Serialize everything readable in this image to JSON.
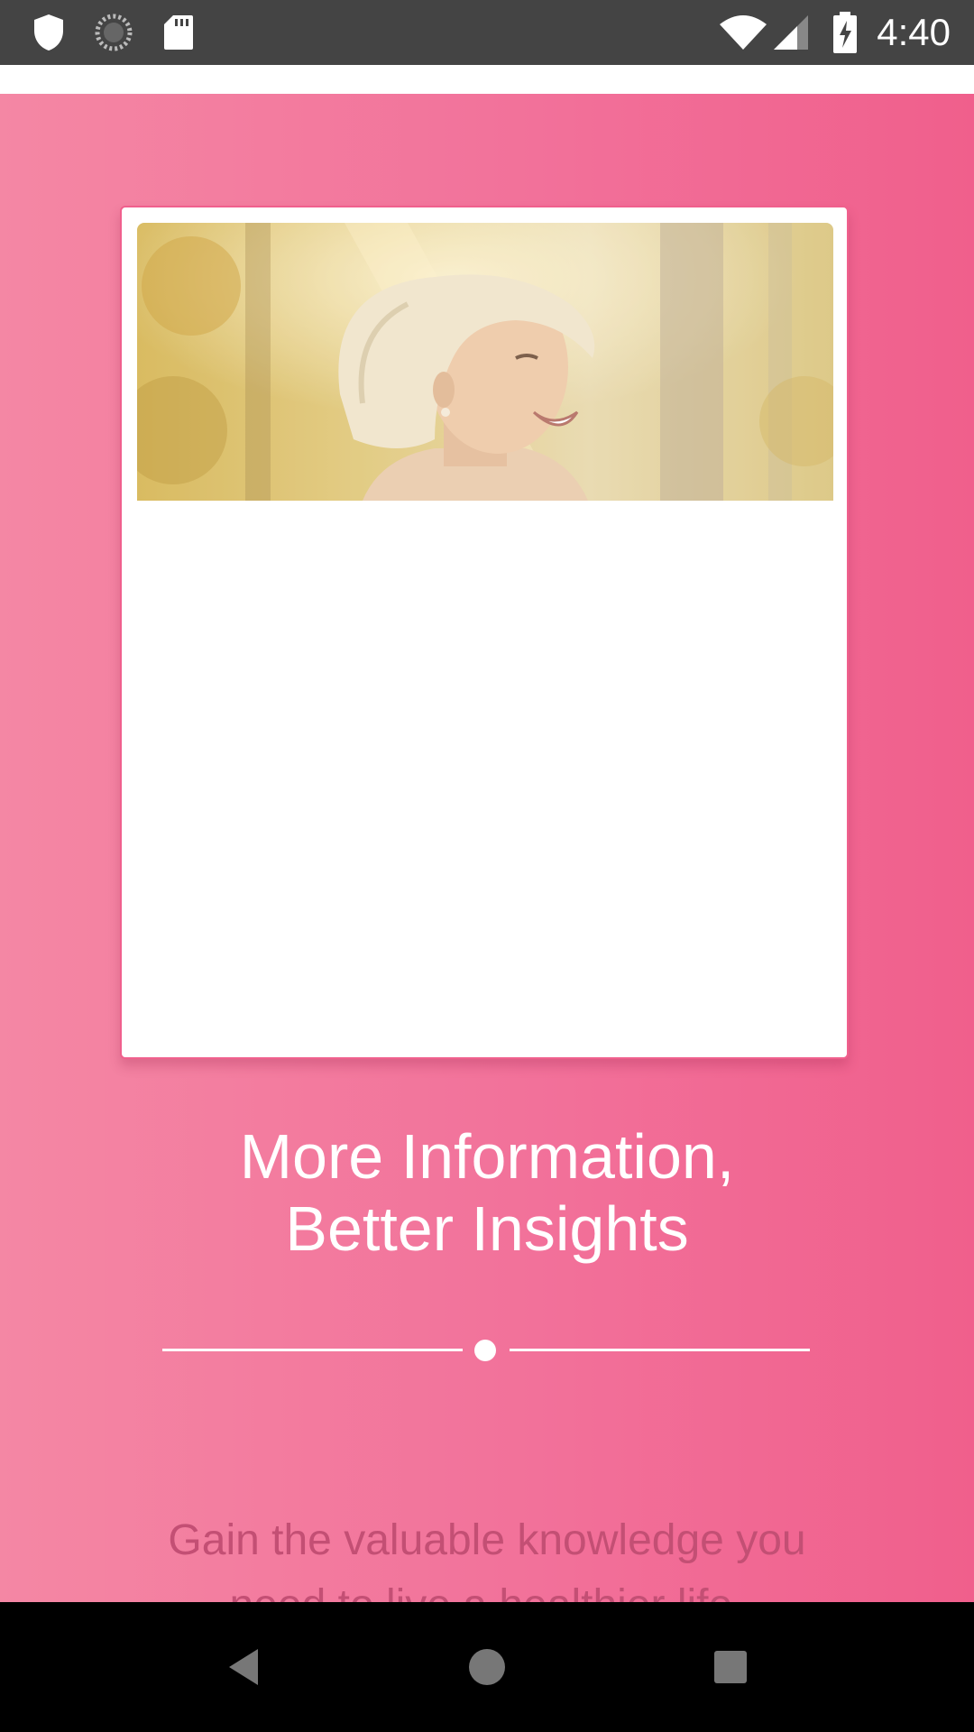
{
  "status_bar": {
    "time": "4:40",
    "icons": [
      "shield-icon",
      "sync-icon",
      "sd-card-icon",
      "wifi-icon",
      "signal-icon",
      "battery-charging-icon"
    ]
  },
  "onboarding": {
    "title_line1": "More Information,",
    "title_line2": "Better Insights",
    "subtitle_line1": "Gain the valuable knowledge you",
    "subtitle_line2": "need to live a healthier life.",
    "colors": {
      "gradient_start": "#f487a4",
      "gradient_end": "#f05f8c",
      "subtitle": "#c34f74",
      "card_border": "#f0608d"
    }
  },
  "nav_bar": {
    "buttons": [
      "back-icon",
      "home-icon",
      "recents-icon"
    ]
  }
}
